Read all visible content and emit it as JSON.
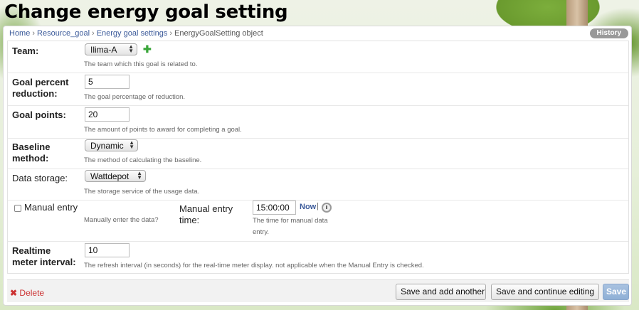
{
  "page": {
    "title": "Change energy goal setting"
  },
  "breadcrumbs": [
    "Home",
    "Resource_goal",
    "Energy goal settings",
    "EnergyGoalSetting object"
  ],
  "history_label": "History",
  "fields": {
    "team": {
      "label": "Team:",
      "value": "Ilima-A",
      "help": "The team which this goal is related to."
    },
    "goal_percent": {
      "label_line1": "Goal percent",
      "label_line2": "reduction:",
      "value": "5",
      "help": "The goal percentage of reduction."
    },
    "goal_points": {
      "label": "Goal points:",
      "value": "20",
      "help": "The amount of points to award for completing a goal."
    },
    "baseline_method": {
      "label_line1": "Baseline",
      "label_line2": "method:",
      "value": "Dynamic",
      "help": "The method of calculating the baseline."
    },
    "data_storage": {
      "label": "Data storage:",
      "value": "Wattdepot",
      "help": "The storage service of the usage data."
    },
    "manual_entry": {
      "label": "Manual entry",
      "checked": false,
      "help": "Manually enter the data?"
    },
    "manual_entry_time": {
      "label_line1": "Manual entry",
      "label_line2": "time:",
      "value": "15:00:00",
      "now_label": "Now",
      "separator": "|",
      "help_line1": "The time for manual data",
      "help_line2": "entry."
    },
    "realtime_interval": {
      "label_line1": "Realtime",
      "label_line2": "meter interval:",
      "value": "10",
      "help": "The refresh interval (in seconds) for the real-time meter display. not applicable when the Manual Entry is checked."
    }
  },
  "actions": {
    "delete_label": "Delete",
    "save_add_another": "Save and add another",
    "save_continue": "Save and continue editing",
    "save": "Save"
  },
  "colors": {
    "link": "#3b5a9a",
    "add_icon": "#3aa63a",
    "delete": "#cc3333",
    "primary_button": "#8fb0d6"
  }
}
